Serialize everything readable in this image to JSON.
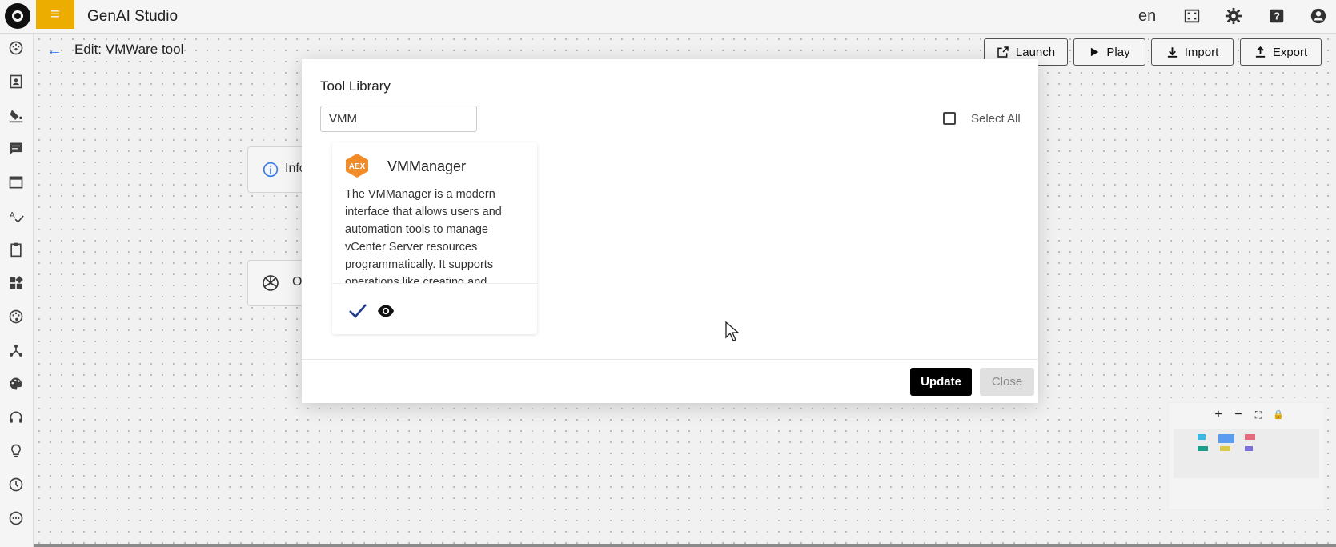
{
  "app": {
    "title": "GenAI Studio",
    "language": "en"
  },
  "topbar": {
    "icons": [
      "fullscreen-icon",
      "settings-icon",
      "help-icon",
      "account-icon"
    ]
  },
  "sidebar": {
    "icons": [
      "dashboard-icon",
      "contacts-icon",
      "paint-bucket-icon",
      "chat-icon",
      "browser-icon",
      "spellcheck-icon",
      "clipboard-icon",
      "widgets-icon",
      "palette-icon",
      "graph-icon",
      "theme-icon",
      "headset-icon",
      "lightbulb-icon",
      "clock-icon",
      "more-icon"
    ]
  },
  "page": {
    "title": "Edit: VMWare tool"
  },
  "toolbar": {
    "launch": "Launch",
    "play": "Play",
    "import": "Import",
    "export": "Export"
  },
  "nodes": {
    "info_label": "Info",
    "openai_label": "O"
  },
  "modal": {
    "title": "Tool Library",
    "search_value": "VMM",
    "select_all": "Select All",
    "update": "Update",
    "close": "Close",
    "card": {
      "logo_text": "AEX",
      "name": "VMManager",
      "description": "The VMManager is a modern interface that allows users and automation tools to manage vCenter Server resources programmatically. It supports operations like creating and"
    }
  },
  "minimap": {
    "controls": [
      "+",
      "−",
      "⛶",
      "🔒"
    ]
  },
  "colors": {
    "accent": "#f7b500",
    "back_arrow": "#3b82f6",
    "card_logo": "#f28c28",
    "check": "#1e3a8a"
  }
}
